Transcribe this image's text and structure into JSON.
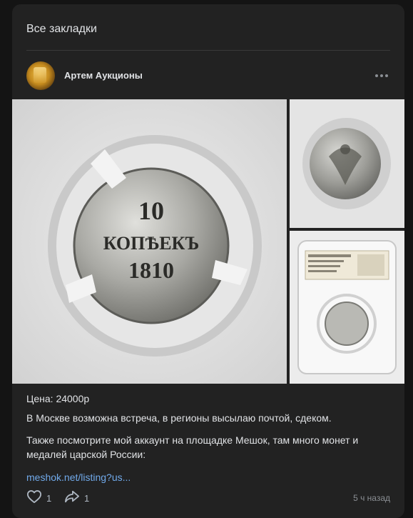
{
  "header": {
    "title": "Все закладки"
  },
  "post": {
    "author": "Артем Аукционы",
    "price": "Цена: 24000р",
    "paragraph1": "В Москве возможна встреча, в регионы высылаю почтой, сдеком.",
    "paragraph2": "Также посмотрите мой аккаунт на площадке Мешок, там много монет и медалей царской России:",
    "link": "meshok.net/listing?us...",
    "likes": "1",
    "shares": "1",
    "time": "5 ч назад"
  },
  "coin": {
    "denomination": "10",
    "word": "КОПѢЕКЪ",
    "year": "1810"
  },
  "icons": {
    "more": "more-dots-icon",
    "like": "heart-icon",
    "share": "share-arrow-icon"
  },
  "colors": {
    "background": "#141414",
    "panel": "#222222",
    "link": "#71aaeb",
    "muted": "#8b8f94"
  }
}
